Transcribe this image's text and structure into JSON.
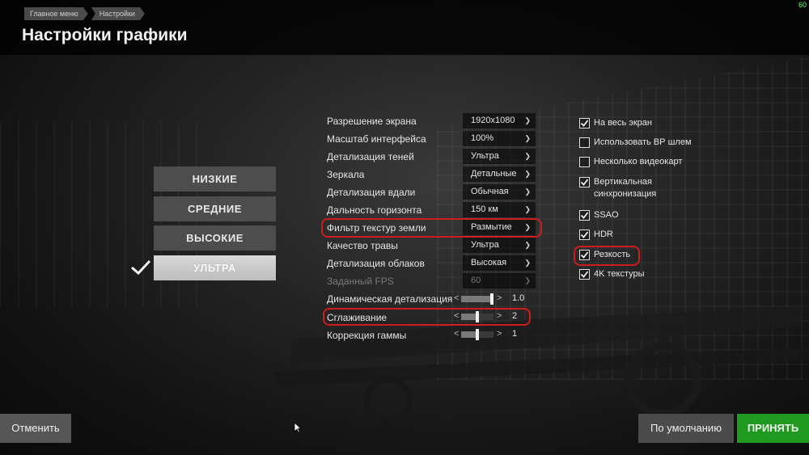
{
  "header": {
    "breadcrumb": [
      "Главное меню",
      "Настройки"
    ],
    "title": "Настройки графики",
    "fps": "60"
  },
  "presets": [
    {
      "label": "НИЗКИЕ",
      "active": false
    },
    {
      "label": "СРЕДНИЕ",
      "active": false
    },
    {
      "label": "ВЫСОКИЕ",
      "active": false
    },
    {
      "label": "УЛЬТРА",
      "active": true
    }
  ],
  "settings": {
    "dropdowns": [
      {
        "label": "Разрешение экрана",
        "value": "1920x1080",
        "disabled": false
      },
      {
        "label": "Масштаб интерфейса",
        "value": "100%",
        "disabled": false
      },
      {
        "label": "Детализация теней",
        "value": "Ультра",
        "disabled": false
      },
      {
        "label": "Зеркала",
        "value": "Детальные",
        "disabled": false
      },
      {
        "label": "Детализация вдали",
        "value": "Обычная",
        "disabled": false
      },
      {
        "label": "Дальность горизонта",
        "value": "150 км",
        "disabled": false
      },
      {
        "label": "Фильтр текстур земли",
        "value": "Размытие",
        "disabled": false
      },
      {
        "label": "Качество травы",
        "value": "Ультра",
        "disabled": false
      },
      {
        "label": "Детализация облаков",
        "value": "Высокая",
        "disabled": false
      },
      {
        "label": "Заданный FPS",
        "value": "60",
        "disabled": true
      }
    ],
    "sliders": [
      {
        "label": "Динамическая детализация",
        "value": "1.0",
        "level": 1.0
      },
      {
        "label": "Сглаживание",
        "value": "2",
        "level": 0.5
      },
      {
        "label": "Коррекция гаммы",
        "value": "1",
        "level": 0.5
      }
    ]
  },
  "checkboxes": [
    {
      "label": "На весь экран",
      "checked": true
    },
    {
      "label": "Использовать ВР шлем",
      "checked": false
    },
    {
      "label": "Несколько видеокарт",
      "checked": false
    },
    {
      "label": "Вертикальная\nсинхронизация",
      "checked": true
    },
    {
      "label": "SSAO",
      "checked": true
    },
    {
      "label": "HDR",
      "checked": true
    },
    {
      "label": "Резкость",
      "checked": true
    },
    {
      "label": "4K текстуры",
      "checked": true
    }
  ],
  "buttons": {
    "cancel": "Отменить",
    "default": "По умолчанию",
    "accept": "ПРИНЯТЬ"
  },
  "colors": {
    "accept": "#1f9a1f",
    "highlight": "#d01c1c",
    "fps": "#6cff6c"
  }
}
